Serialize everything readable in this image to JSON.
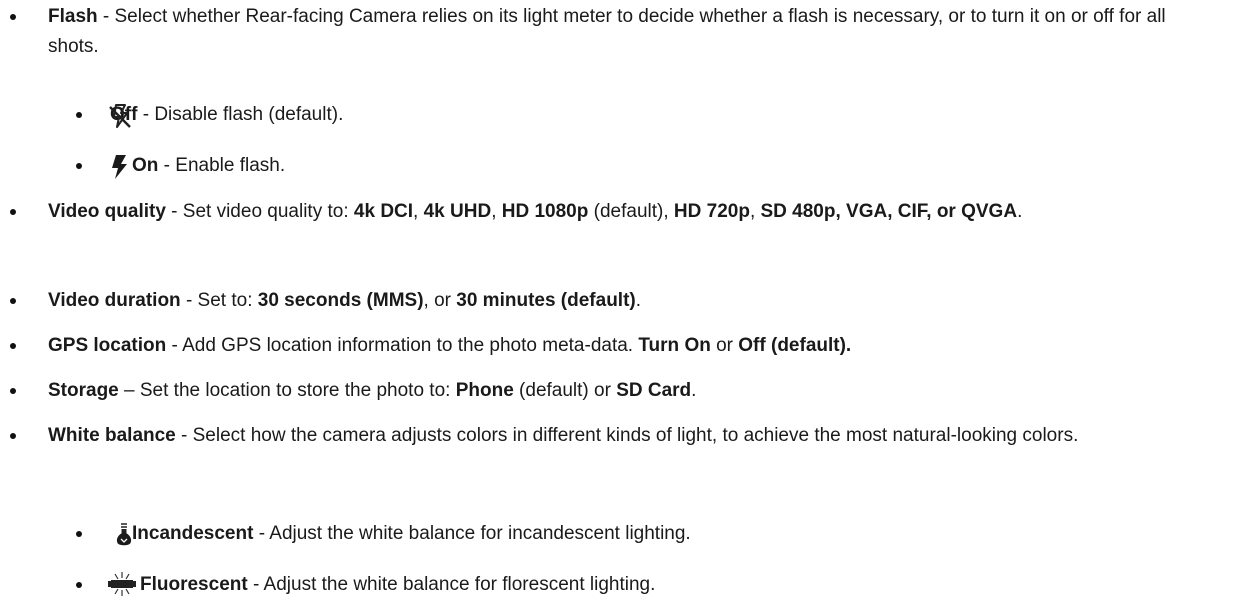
{
  "items": {
    "flash": {
      "term": "Flash",
      "desc": " - Select whether Rear-facing Camera relies on its light meter to decide whether a flash is necessary, or to turn it on or off for all shots.",
      "off": {
        "icon": "flash-off-icon",
        "term": "Off",
        "desc": " - Disable flash (default)."
      },
      "on": {
        "icon": "flash-on-icon",
        "term": "On",
        "desc": " - Enable flash."
      }
    },
    "video_quality": {
      "term": "Video quality",
      "desc_a": " - Set video quality to: ",
      "opt1": "4k DCI",
      "sep1": ", ",
      "opt2": "4k UHD",
      "sep2": ", ",
      "opt3": "HD 1080p",
      "desc_b": " (default), ",
      "opt4": "HD 720p",
      "sep3": ", ",
      "opt5": "SD 480p, VGA, CIF, or QVGA",
      "end": "."
    },
    "video_duration": {
      "term": "Video duration",
      "desc_a": " - Set to: ",
      "opt1": "30 seconds (MMS)",
      "desc_b": ", or ",
      "opt2": "30 minutes (default)",
      "end": "."
    },
    "gps": {
      "term": "GPS location",
      "desc_a": " - Add GPS location information to the photo meta-data. ",
      "opt1": "Turn On",
      "desc_b": " or ",
      "opt2": "Off (default)."
    },
    "storage": {
      "term": "Storage",
      "desc_a": " – Set the location to store the photo to: ",
      "opt1": "Phone",
      "desc_b": " (default) or ",
      "opt2": "SD Card",
      "end": "."
    },
    "white_balance": {
      "term": "White balance",
      "desc": " - Select how the camera adjusts colors in different kinds of light, to achieve the most natural-looking colors.",
      "incandescent": {
        "icon": "incandescent-bulb-icon",
        "term": "Incandescent",
        "desc": " - Adjust the white balance for incandescent lighting."
      },
      "fluorescent": {
        "icon": "fluorescent-tube-icon",
        "term": "Fluorescent",
        "desc": " - Adjust the white balance for florescent lighting."
      }
    }
  }
}
